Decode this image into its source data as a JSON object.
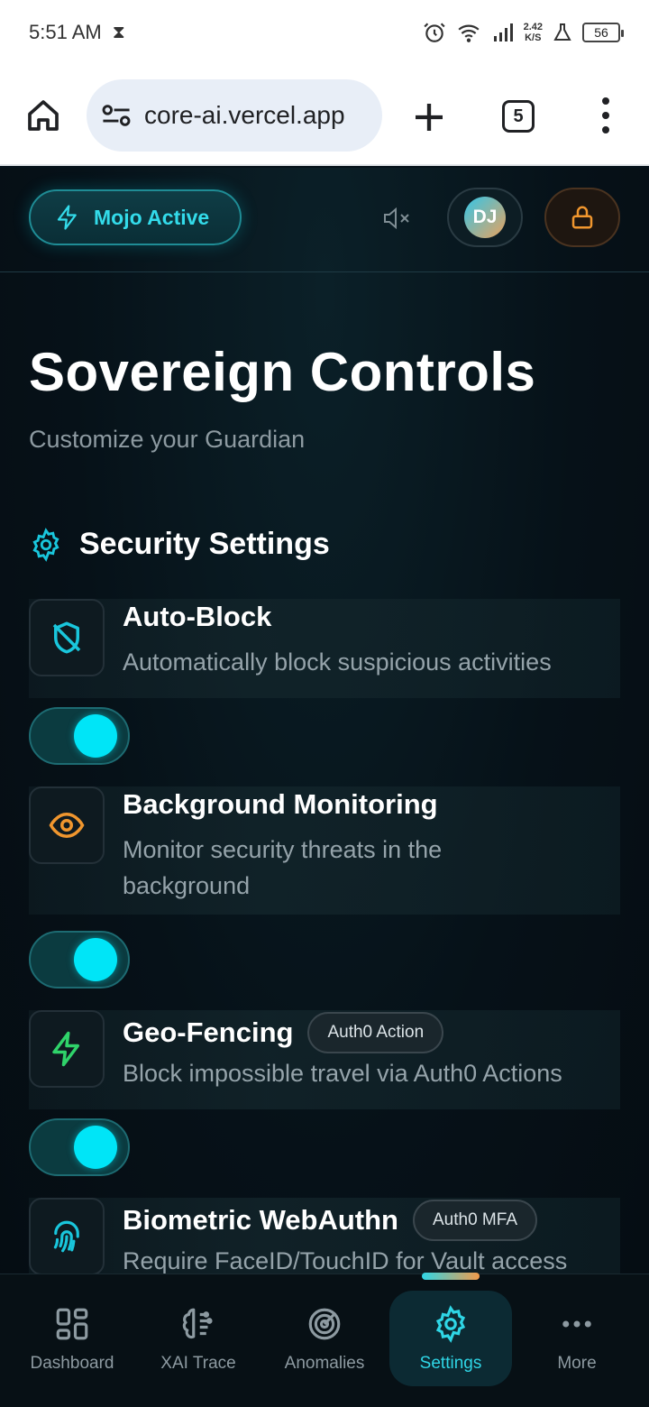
{
  "status_bar": {
    "time": "5:51 AM",
    "net_speed_value": "2.42",
    "net_speed_unit": "K/S",
    "battery": "56"
  },
  "browser": {
    "url": "core-ai.vercel.app",
    "tab_count": "5"
  },
  "header": {
    "mojo_label": "Mojo Active",
    "avatar_initials": "DJ"
  },
  "page": {
    "title": "Sovereign Controls",
    "subtitle": "Customize your Guardian"
  },
  "section": {
    "title": "Security Settings"
  },
  "settings": [
    {
      "title": "Auto-Block",
      "description": "Automatically block suspicious activities",
      "badge": "",
      "enabled": true,
      "icon": "shield-off-icon",
      "icon_color": "#19c6dc"
    },
    {
      "title": "Background Monitoring",
      "description": "Monitor security threats in the background",
      "badge": "",
      "enabled": true,
      "icon": "eye-icon",
      "icon_color": "#f0962e"
    },
    {
      "title": "Geo-Fencing",
      "description": "Block impossible travel via Auth0 Actions",
      "badge": "Auth0 Action",
      "enabled": true,
      "icon": "zap-icon",
      "icon_color": "#2fd36a"
    },
    {
      "title": "Biometric WebAuthn",
      "description": "Require FaceID/TouchID for Vault access",
      "badge": "Auth0 MFA",
      "enabled": true,
      "icon": "fingerprint-icon",
      "icon_color": "#19c6dc"
    }
  ],
  "bottom_nav": {
    "items": [
      {
        "label": "Dashboard",
        "icon": "dashboard-icon"
      },
      {
        "label": "XAI Trace",
        "icon": "brain-icon"
      },
      {
        "label": "Anomalies",
        "icon": "radar-icon"
      },
      {
        "label": "Settings",
        "icon": "gear-icon"
      },
      {
        "label": "More",
        "icon": "more-icon"
      }
    ],
    "active": "Settings"
  },
  "colors": {
    "accent": "#2fd6e6",
    "background": "#06121a",
    "toggle_on": "#00e5f7"
  }
}
